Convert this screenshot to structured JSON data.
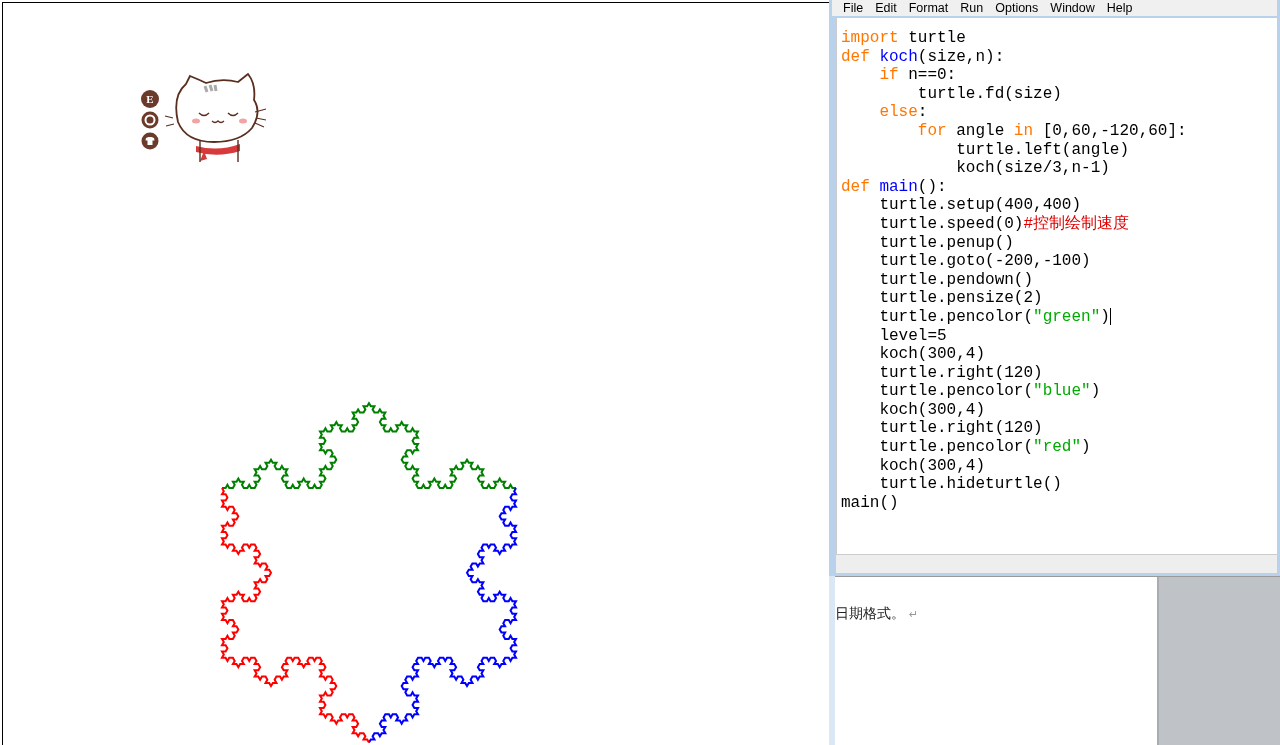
{
  "sticker": {
    "badges": [
      {
        "kind": "letter",
        "label": "E"
      },
      {
        "kind": "ring"
      },
      {
        "kind": "shirt"
      }
    ]
  },
  "editor": {
    "menu": [
      "File",
      "Edit",
      "Format",
      "Run",
      "Options",
      "Window",
      "Help"
    ],
    "lines": [
      {
        "caret": false,
        "tokens": [
          {
            "kind": "keyword",
            "text": "import"
          },
          {
            "kind": "plain",
            "text": " turtle"
          }
        ]
      },
      {
        "caret": false,
        "tokens": [
          {
            "kind": "keyword",
            "text": "def"
          },
          {
            "kind": "name",
            "text": " koch"
          },
          {
            "kind": "plain",
            "text": "(size,n):"
          }
        ]
      },
      {
        "caret": false,
        "tokens": [
          {
            "kind": "keyword",
            "text": "    if"
          },
          {
            "kind": "plain",
            "text": " n==0:"
          }
        ]
      },
      {
        "caret": false,
        "tokens": [
          {
            "kind": "plain",
            "text": "        turtle.fd(size)"
          }
        ]
      },
      {
        "caret": false,
        "tokens": [
          {
            "kind": "keyword",
            "text": "    else"
          },
          {
            "kind": "plain",
            "text": ":"
          }
        ]
      },
      {
        "caret": false,
        "tokens": [
          {
            "kind": "keyword",
            "text": "        for"
          },
          {
            "kind": "plain",
            "text": " angle"
          },
          {
            "kind": "keyword",
            "text": " in"
          },
          {
            "kind": "plain",
            "text": " [0,60,-120,60]:"
          }
        ]
      },
      {
        "caret": false,
        "tokens": [
          {
            "kind": "plain",
            "text": "            turtle.left(angle)"
          }
        ]
      },
      {
        "caret": false,
        "tokens": [
          {
            "kind": "plain",
            "text": "            koch(size/3,n-1)"
          }
        ]
      },
      {
        "caret": false,
        "tokens": [
          {
            "kind": "keyword",
            "text": "def"
          },
          {
            "kind": "name",
            "text": " main"
          },
          {
            "kind": "plain",
            "text": "():"
          }
        ]
      },
      {
        "caret": false,
        "tokens": [
          {
            "kind": "plain",
            "text": "    turtle.setup(400,400)"
          }
        ]
      },
      {
        "caret": false,
        "tokens": [
          {
            "kind": "plain",
            "text": "    turtle.speed(0)"
          },
          {
            "kind": "comment",
            "text": "#控制绘制速度"
          }
        ]
      },
      {
        "caret": false,
        "tokens": [
          {
            "kind": "plain",
            "text": "    turtle.penup()"
          }
        ]
      },
      {
        "caret": false,
        "tokens": [
          {
            "kind": "plain",
            "text": "    turtle.goto(-200,-100)"
          }
        ]
      },
      {
        "caret": false,
        "tokens": [
          {
            "kind": "plain",
            "text": "    turtle.pendown()"
          }
        ]
      },
      {
        "caret": false,
        "tokens": [
          {
            "kind": "plain",
            "text": "    turtle.pensize(2)"
          }
        ]
      },
      {
        "caret": true,
        "tokens": [
          {
            "kind": "plain",
            "text": "    turtle.pencolor("
          },
          {
            "kind": "string",
            "text": "\"green\""
          },
          {
            "kind": "plain",
            "text": ")"
          }
        ]
      },
      {
        "caret": false,
        "tokens": [
          {
            "kind": "plain",
            "text": "    level=5"
          }
        ]
      },
      {
        "caret": false,
        "tokens": [
          {
            "kind": "plain",
            "text": "    koch(300,4)"
          }
        ]
      },
      {
        "caret": false,
        "tokens": [
          {
            "kind": "plain",
            "text": "    turtle.right(120)"
          }
        ]
      },
      {
        "caret": false,
        "tokens": [
          {
            "kind": "plain",
            "text": "    turtle.pencolor("
          },
          {
            "kind": "string",
            "text": "\"blue\""
          },
          {
            "kind": "plain",
            "text": ")"
          }
        ]
      },
      {
        "caret": false,
        "tokens": [
          {
            "kind": "plain",
            "text": "    koch(300,4)"
          }
        ]
      },
      {
        "caret": false,
        "tokens": [
          {
            "kind": "plain",
            "text": "    turtle.right(120)"
          }
        ]
      },
      {
        "caret": false,
        "tokens": [
          {
            "kind": "plain",
            "text": "    turtle.pencolor("
          },
          {
            "kind": "string",
            "text": "\"red\""
          },
          {
            "kind": "plain",
            "text": ")"
          }
        ]
      },
      {
        "caret": false,
        "tokens": [
          {
            "kind": "plain",
            "text": "    koch(300,4)"
          }
        ]
      },
      {
        "caret": false,
        "tokens": [
          {
            "kind": "plain",
            "text": "    turtle.hideturtle()"
          }
        ]
      },
      {
        "caret": false,
        "tokens": [
          {
            "kind": "plain",
            "text": "main()"
          }
        ]
      }
    ]
  },
  "document": {
    "text": "日期格式。",
    "paragraph_mark": "↵"
  }
}
